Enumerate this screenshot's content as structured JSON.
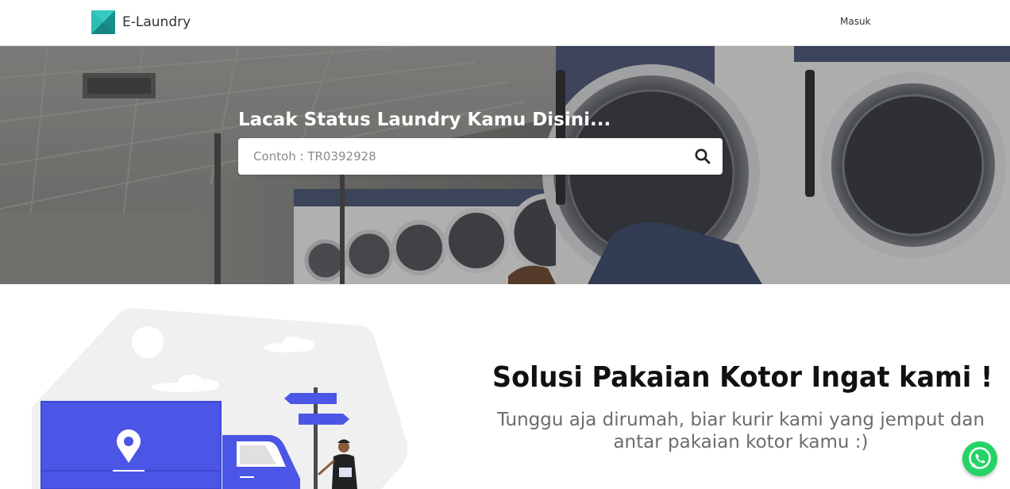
{
  "navbar": {
    "brand_name": "E-Laundry",
    "login_label": "Masuk"
  },
  "hero": {
    "title": "Lacak Status Laundry Kamu Disini...",
    "search_placeholder": "Contoh : TR0392928",
    "search_value": ""
  },
  "feature": {
    "title": "Solusi Pakaian Kotor Ingat kami !",
    "subtitle": "Tunggu aja dirumah, biar kurir kami yang jemput dan antar pakaian kotor kamu :)"
  },
  "icons": {
    "brand_logo": "e-laundry-logo-icon",
    "search": "search-icon",
    "whatsapp": "whatsapp-icon",
    "location_pin": "location-pin-icon"
  },
  "colors": {
    "brand_teal": "#1fa6a0",
    "truck_blue": "#4b55e6",
    "whatsapp_green": "#25d366",
    "illustration_bg": "#f0f0f0"
  }
}
